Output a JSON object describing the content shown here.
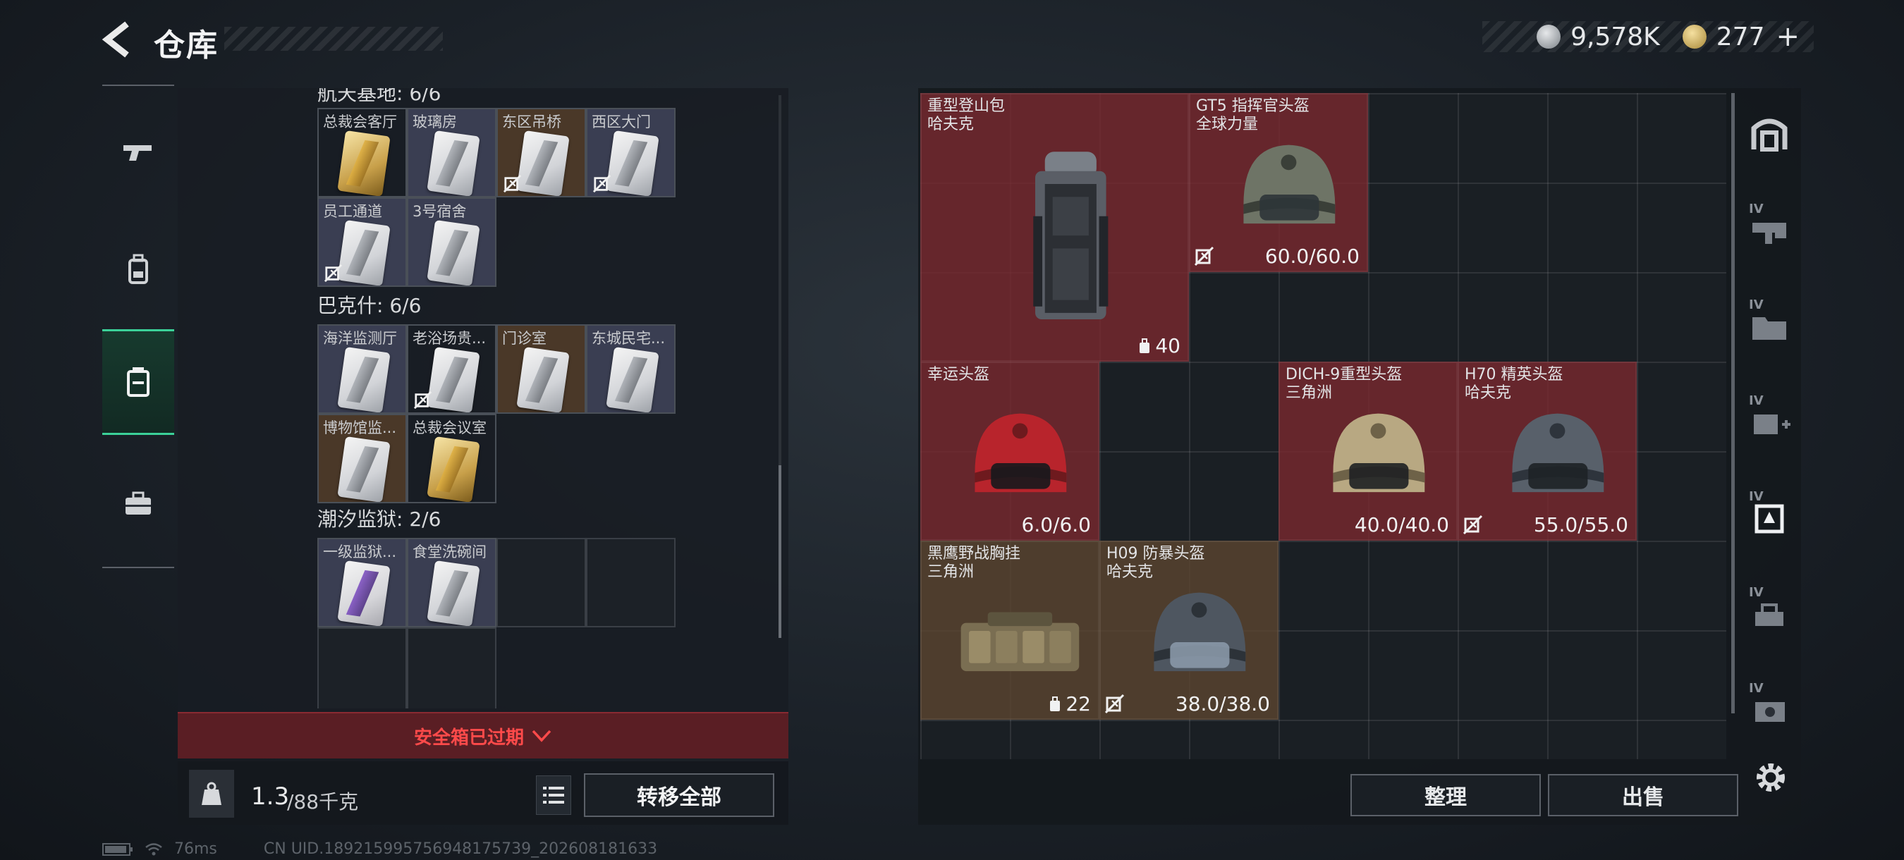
{
  "header": {
    "title": "仓库",
    "currency_silver": "9,578K",
    "currency_gold": "277",
    "plus_label": "+"
  },
  "nav": {
    "items": [
      {
        "name": "weapons",
        "icon": "gun-icon",
        "active": false
      },
      {
        "name": "equipment",
        "icon": "backpack-icon",
        "active": false
      },
      {
        "name": "keys",
        "icon": "keycard-box-icon",
        "active": true
      },
      {
        "name": "items",
        "icon": "briefcase-icon",
        "active": false
      }
    ]
  },
  "keys": {
    "groups": [
      {
        "title": "航天基地: 6/6",
        "slots": [
          {
            "label": "总裁会客厅",
            "card": "gold",
            "color": "red",
            "nobind": false
          },
          {
            "label": "玻璃房",
            "card": "silver",
            "color": "silver",
            "nobind": false
          },
          {
            "label": "东区吊桥",
            "card": "silver",
            "color": "orange",
            "nobind": true
          },
          {
            "label": "西区大门",
            "card": "silver",
            "color": "silver",
            "nobind": true
          },
          {
            "label": "员工通道",
            "card": "silver",
            "color": "silver",
            "nobind": true
          },
          {
            "label": "3号宿舍",
            "card": "silver",
            "color": "silver",
            "nobind": false
          }
        ]
      },
      {
        "title": "巴克什: 6/6",
        "slots": [
          {
            "label": "海洋监测厅",
            "card": "silver",
            "color": "silver",
            "nobind": false
          },
          {
            "label": "老浴场贵...",
            "card": "silver",
            "color": "red",
            "nobind": true
          },
          {
            "label": "门诊室",
            "card": "silver",
            "color": "orange",
            "nobind": false
          },
          {
            "label": "东城民宅...",
            "card": "silver",
            "color": "silver",
            "nobind": false
          },
          {
            "label": "博物馆监...",
            "card": "silver",
            "color": "orange",
            "nobind": false
          },
          {
            "label": "总裁会议室",
            "card": "gold",
            "color": "red",
            "nobind": false
          }
        ]
      },
      {
        "title": "潮汐监狱: 2/6",
        "slots": [
          {
            "label": "一级监狱...",
            "card": "purple",
            "color": "silver",
            "nobind": false
          },
          {
            "label": "食堂洗碗间",
            "card": "silver",
            "color": "silver",
            "nobind": false
          }
        ]
      }
    ],
    "expired_text": "安全箱已过期",
    "weight_current": "1.3",
    "weight_max": "/88千克",
    "transfer_label": "转移全部"
  },
  "inventory": {
    "items": [
      {
        "name": "重型登山包\n哈夫克",
        "value": "40",
        "value_type": "capacity",
        "color": "red",
        "nobind": false,
        "art": "backpack"
      },
      {
        "name": "GT5 指挥官头盔\n全球力量",
        "value": "60.0/60.0",
        "value_type": "durability",
        "color": "red",
        "nobind": true,
        "art": "helmet-green"
      },
      {
        "name": "幸运头盔",
        "value": "6.0/6.0",
        "value_type": "durability",
        "color": "red",
        "nobind": false,
        "art": "helmet-red"
      },
      {
        "name": "DICH-9重型头盔\n三角洲",
        "value": "40.0/40.0",
        "value_type": "durability",
        "color": "red",
        "nobind": false,
        "art": "helmet-tan"
      },
      {
        "name": "H70 精英头盔\n哈夫克",
        "value": "55.0/55.0",
        "value_type": "durability",
        "color": "red",
        "nobind": true,
        "art": "helmet-dark"
      },
      {
        "name": "黑鹰野战胸挂\n三角洲",
        "value": "22",
        "value_type": "capacity",
        "color": "brown",
        "nobind": false,
        "art": "vest"
      },
      {
        "name": "H09 防暴头盔\n哈夫克",
        "value": "38.0/38.0",
        "value_type": "durability",
        "color": "brown",
        "nobind": true,
        "art": "helmet-visor"
      }
    ],
    "tidy_label": "整理",
    "sell_label": "出售"
  },
  "right_nav": {
    "items": [
      {
        "name": "safe-box",
        "icon": "vault-icon",
        "level": ""
      },
      {
        "name": "weapon-rack",
        "icon": "weapon-rack-icon",
        "level": "IV"
      },
      {
        "name": "folder",
        "icon": "folder-icon",
        "level": "IV"
      },
      {
        "name": "medical",
        "icon": "medical-icon",
        "level": "IV"
      },
      {
        "name": "keycard",
        "icon": "keycard-icon",
        "level": "IV"
      },
      {
        "name": "tools",
        "icon": "tools-icon",
        "level": "IV"
      },
      {
        "name": "display",
        "icon": "display-icon",
        "level": "IV"
      }
    ]
  },
  "status": {
    "ping": "76ms",
    "uid": "CN UID.189215995756948175739_202608181633"
  },
  "colors": {
    "accent_green": "#3bd199",
    "expired_red": "#ff4a4a",
    "item_red": "#782e34",
    "item_brown": "#5a4430"
  }
}
